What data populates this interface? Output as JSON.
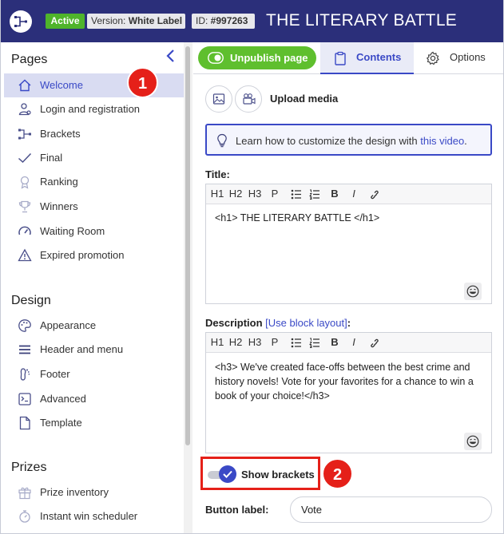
{
  "header": {
    "status_badge": "Active",
    "version_prefix": "Version: ",
    "version_value": "White Label",
    "id_prefix": "ID: ",
    "id_value": "#997263",
    "title": "THE LITERARY BATTLE",
    "header_color": "#2b2f7a"
  },
  "sidebar": {
    "sections": [
      {
        "title": "Pages",
        "items": [
          {
            "label": "Welcome",
            "icon": "home-icon",
            "active": true
          },
          {
            "label": "Login and registration",
            "icon": "user-key-icon"
          },
          {
            "label": "Brackets",
            "icon": "brackets-icon"
          },
          {
            "label": "Final",
            "icon": "check-icon"
          },
          {
            "label": "Ranking",
            "icon": "medal-icon"
          },
          {
            "label": "Winners",
            "icon": "trophy-icon"
          },
          {
            "label": "Waiting Room",
            "icon": "gauge-icon"
          },
          {
            "label": "Expired promotion",
            "icon": "warning-icon"
          }
        ]
      },
      {
        "title": "Design",
        "items": [
          {
            "label": "Appearance",
            "icon": "palette-icon"
          },
          {
            "label": "Header and menu",
            "icon": "menu-icon"
          },
          {
            "label": "Footer",
            "icon": "footer-icon"
          },
          {
            "label": "Advanced",
            "icon": "code-icon"
          },
          {
            "label": "Template",
            "icon": "file-icon"
          }
        ]
      },
      {
        "title": "Prizes",
        "items": [
          {
            "label": "Prize inventory",
            "icon": "gift-icon"
          },
          {
            "label": "Instant win scheduler",
            "icon": "stopwatch-icon"
          }
        ]
      }
    ]
  },
  "markers": {
    "one": "1",
    "two": "2"
  },
  "main": {
    "unpublish_label": "Unpublish page",
    "tabs": [
      {
        "label": "Contents",
        "icon": "clipboard-icon",
        "active": true
      },
      {
        "label": "Options",
        "icon": "gear-icon"
      }
    ],
    "upload_media_label": "Upload media",
    "info_text": "Learn how to customize the design with ",
    "info_link": "this video",
    "info_suffix": ".",
    "title_field": {
      "label": "Title:",
      "value": "<h1> THE LITERARY BATTLE </h1>"
    },
    "description_field": {
      "label": "Description",
      "block_link": "[Use block layout]",
      "colon": ":",
      "value": "<h3> We've created face-offs between the best crime and history novels! Vote for your favorites for a chance to win a book of your choice!</h3>"
    },
    "toolbar": {
      "h1": "H1",
      "h2": "H2",
      "h3": "H3",
      "p": "P",
      "b": "B",
      "i": "I"
    },
    "show_brackets": {
      "label": "Show brackets",
      "checked": true
    },
    "button_label": {
      "label": "Button label:",
      "value": "Vote"
    },
    "accent_color": "#3a49c6",
    "publish_color": "#5fbf2e",
    "marker_color": "#e52019"
  }
}
